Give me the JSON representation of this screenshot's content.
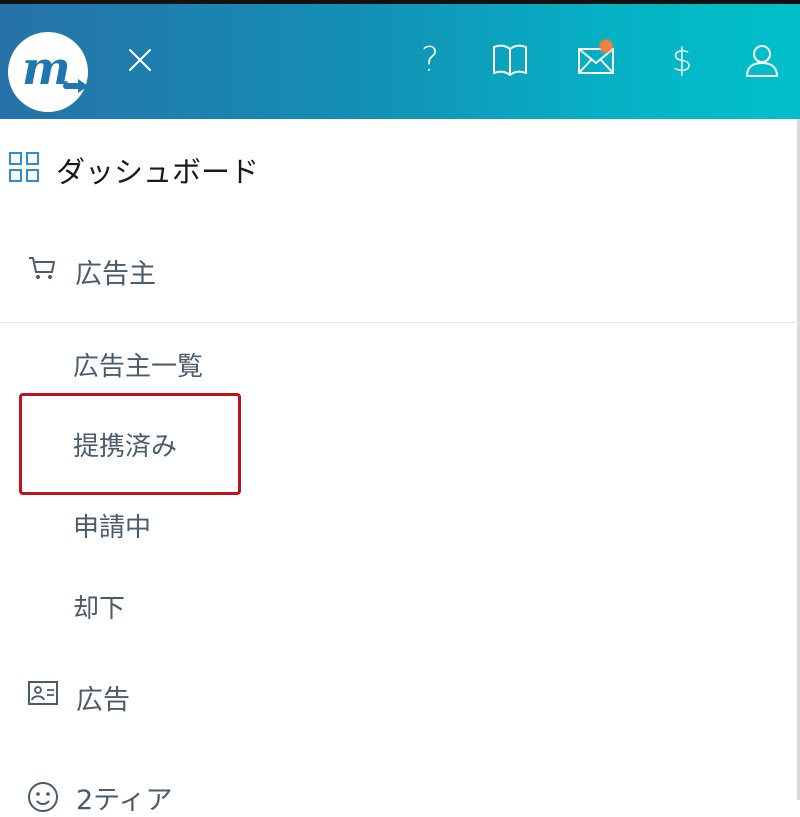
{
  "header": {
    "logo_letter": "m",
    "icons": [
      "close-icon",
      "help-icon",
      "book-icon",
      "mail-icon",
      "dollar-icon",
      "user-icon"
    ],
    "help_glyph": "?",
    "dollar_glyph": "$",
    "mail_badge_color": "#f1813f"
  },
  "menu": {
    "dashboard": {
      "label": "ダッシュボード",
      "icon": "grid-icon"
    },
    "advertiser": {
      "label": "広告主",
      "icon": "cart-icon",
      "children": [
        {
          "label": "広告主一覧"
        },
        {
          "label": "提携済み",
          "highlighted": true
        },
        {
          "label": "申請中"
        },
        {
          "label": "却下"
        }
      ]
    },
    "ads": {
      "label": "広告",
      "icon": "id-card-icon"
    },
    "tier2": {
      "label": "2ティア",
      "icon": "smiley-icon"
    }
  },
  "colors": {
    "header_start": "#2672a8",
    "header_end": "#00bfca",
    "highlight_border": "#c0121c",
    "dashboard_icon": "#2b8fd6"
  }
}
